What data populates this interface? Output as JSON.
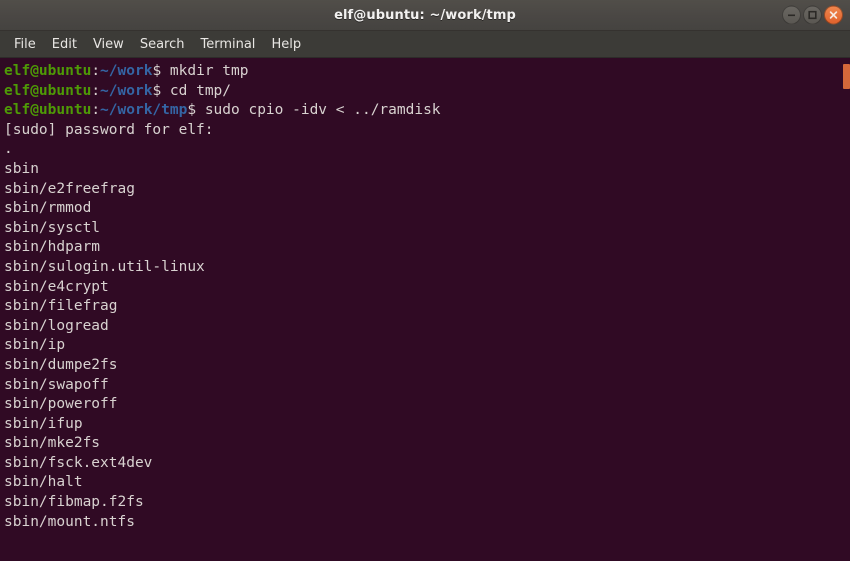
{
  "window": {
    "title": "elf@ubuntu: ~/work/tmp",
    "controls": {
      "minimize_label": "minimize",
      "maximize_label": "maximize",
      "close_label": "close"
    }
  },
  "menubar": {
    "items": [
      {
        "label": "File"
      },
      {
        "label": "Edit"
      },
      {
        "label": "View"
      },
      {
        "label": "Search"
      },
      {
        "label": "Terminal"
      },
      {
        "label": "Help"
      }
    ]
  },
  "terminal": {
    "colors": {
      "background": "#300a24",
      "foreground": "#d8d2d0",
      "prompt_user": "#4e9a06",
      "prompt_path": "#3465a4",
      "titlebar": "#4a4744",
      "menubar": "#3c3b37",
      "close_button": "#e0622c",
      "scrollbar_thumb": "#d4683a"
    },
    "prompts": [
      {
        "user": "elf@ubuntu",
        "sep": ":",
        "path": "~/work",
        "dollar": "$",
        "command": " mkdir tmp"
      },
      {
        "user": "elf@ubuntu",
        "sep": ":",
        "path": "~/work",
        "dollar": "$",
        "command": " cd tmp/"
      },
      {
        "user": "elf@ubuntu",
        "sep": ":",
        "path": "~/work/tmp",
        "dollar": "$",
        "command": " sudo cpio -idv < ../ramdisk"
      }
    ],
    "output": [
      "[sudo] password for elf:",
      ".",
      "sbin",
      "sbin/e2freefrag",
      "sbin/rmmod",
      "sbin/sysctl",
      "sbin/hdparm",
      "sbin/sulogin.util-linux",
      "sbin/e4crypt",
      "sbin/filefrag",
      "sbin/logread",
      "sbin/ip",
      "sbin/dumpe2fs",
      "sbin/swapoff",
      "sbin/poweroff",
      "sbin/ifup",
      "sbin/mke2fs",
      "sbin/fsck.ext4dev",
      "sbin/halt",
      "sbin/fibmap.f2fs",
      "sbin/mount.ntfs"
    ]
  }
}
